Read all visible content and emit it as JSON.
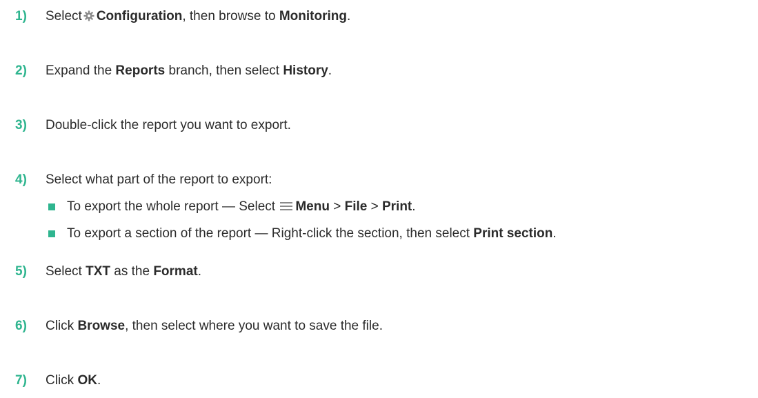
{
  "steps": [
    {
      "number": "1)",
      "before": "Select",
      "bold1": "Configuration",
      "mid": ", then browse to ",
      "bold2": "Monitoring",
      "after": "."
    },
    {
      "number": "2)",
      "before": "Expand the ",
      "bold1": "Reports",
      "mid": " branch, then select ",
      "bold2": "History",
      "after": "."
    },
    {
      "number": "3)",
      "text": "Double-click the report you want to export."
    },
    {
      "number": "4)",
      "text": "Select what part of the report to export:",
      "subitems": [
        {
          "before": "To export the whole report — Select ",
          "b1": "Menu",
          "s1": " > ",
          "b2": "File",
          "s2": " > ",
          "b3": "Print",
          "after": "."
        },
        {
          "before": "To export a section of the report — Right-click the section, then select ",
          "b1": "Print section",
          "after": "."
        }
      ]
    },
    {
      "number": "5)",
      "before": "Select ",
      "bold1": "TXT",
      "mid": " as the ",
      "bold2": "Format",
      "after": "."
    },
    {
      "number": "6)",
      "before": "Click ",
      "bold1": "Browse",
      "after": ", then select where you want to save the file."
    },
    {
      "number": "7)",
      "before": "Click ",
      "bold1": "OK",
      "after": "."
    }
  ],
  "colors": {
    "accent": "#2fb58f",
    "text": "#2b2b2b",
    "icon": "#8a8a8a"
  },
  "icons": {
    "configuration": "gear-icon",
    "menu": "menu-icon",
    "bullet": "square-bullet"
  }
}
